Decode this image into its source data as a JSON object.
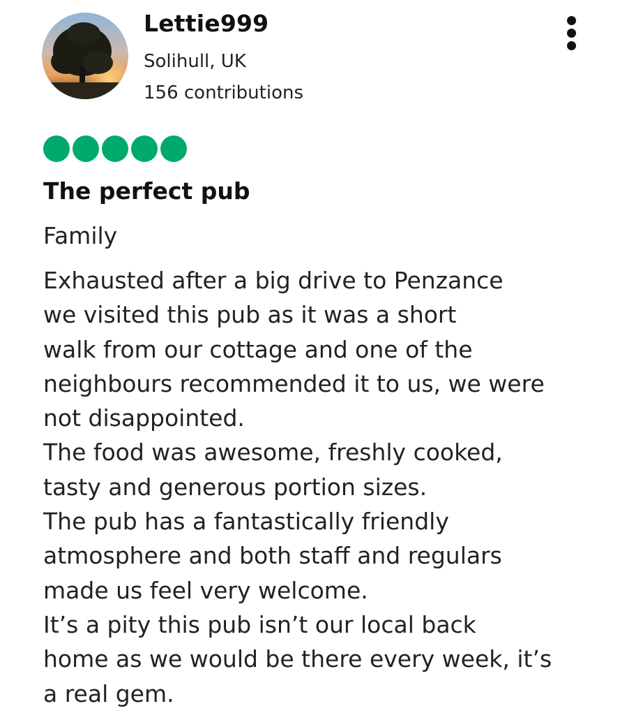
{
  "reviewer": {
    "username": "Lettie999",
    "location": "Solihull, UK",
    "contributions": "156 contributions",
    "avatar_icon": "sunset-tree-avatar"
  },
  "menu": {
    "icon": "more-vertical-icon"
  },
  "rating": {
    "value": 5,
    "max": 5,
    "color": "#00aa6c"
  },
  "review": {
    "title": "The perfect pub",
    "trip_type": "Family",
    "lines": [
      "Exhausted after a big drive to Penzance",
      "we visited this pub as it was a short",
      "walk from our cottage and one of the",
      "neighbours recommended it to us, we were",
      "not disappointed.",
      "The food was awesome, freshly cooked,",
      "tasty and generous portion sizes.",
      "The pub has a fantastically friendly",
      "atmosphere and both staff and regulars",
      "made us feel very welcome.",
      "It’s a pity this pub isn’t our local back",
      "home as we would be there every week, it’s",
      "a real gem."
    ]
  }
}
